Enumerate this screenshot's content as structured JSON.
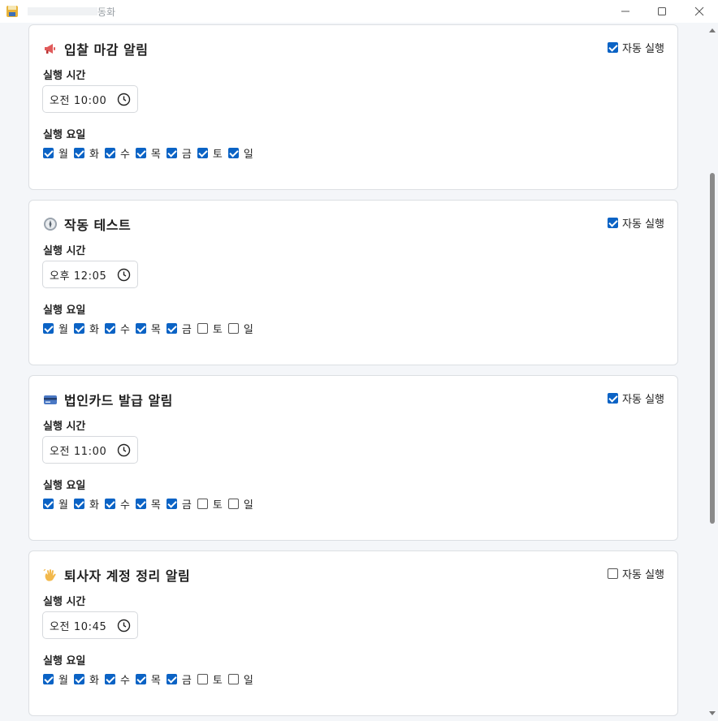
{
  "window": {
    "title_visible": "동화",
    "minimize_icon": "minimize-icon",
    "maximize_icon": "maximize-icon",
    "close_icon": "close-icon"
  },
  "labels": {
    "auto_run": "자동 실행",
    "time": "실행 시간",
    "days": "실행 요일"
  },
  "colors": {
    "accent": "#0b63c5",
    "card_border": "#dcdfe3",
    "background": "#f4f6f9"
  },
  "cards": [
    {
      "icon": "megaphone-icon",
      "title": "입찰 마감 알림",
      "auto_run": true,
      "time": "오전 10:00",
      "days": [
        {
          "label": "월",
          "checked": true
        },
        {
          "label": "화",
          "checked": true
        },
        {
          "label": "수",
          "checked": true
        },
        {
          "label": "목",
          "checked": true
        },
        {
          "label": "금",
          "checked": true
        },
        {
          "label": "토",
          "checked": true
        },
        {
          "label": "일",
          "checked": true
        }
      ]
    },
    {
      "icon": "compass-icon",
      "title": "작동 테스트",
      "auto_run": true,
      "time": "오후 12:05",
      "days": [
        {
          "label": "월",
          "checked": true
        },
        {
          "label": "화",
          "checked": true
        },
        {
          "label": "수",
          "checked": true
        },
        {
          "label": "목",
          "checked": true
        },
        {
          "label": "금",
          "checked": true
        },
        {
          "label": "토",
          "checked": false
        },
        {
          "label": "일",
          "checked": false
        }
      ]
    },
    {
      "icon": "credit-card-icon",
      "title": "법인카드 발급 알림",
      "auto_run": true,
      "time": "오전 11:00",
      "days": [
        {
          "label": "월",
          "checked": true
        },
        {
          "label": "화",
          "checked": true
        },
        {
          "label": "수",
          "checked": true
        },
        {
          "label": "목",
          "checked": true
        },
        {
          "label": "금",
          "checked": true
        },
        {
          "label": "토",
          "checked": false
        },
        {
          "label": "일",
          "checked": false
        }
      ]
    },
    {
      "icon": "waving-hand-icon",
      "title": "퇴사자 계정 정리 알림",
      "auto_run": false,
      "time": "오전 10:45",
      "days": [
        {
          "label": "월",
          "checked": true
        },
        {
          "label": "화",
          "checked": true
        },
        {
          "label": "수",
          "checked": true
        },
        {
          "label": "목",
          "checked": true
        },
        {
          "label": "금",
          "checked": true
        },
        {
          "label": "토",
          "checked": false
        },
        {
          "label": "일",
          "checked": false
        }
      ]
    }
  ]
}
